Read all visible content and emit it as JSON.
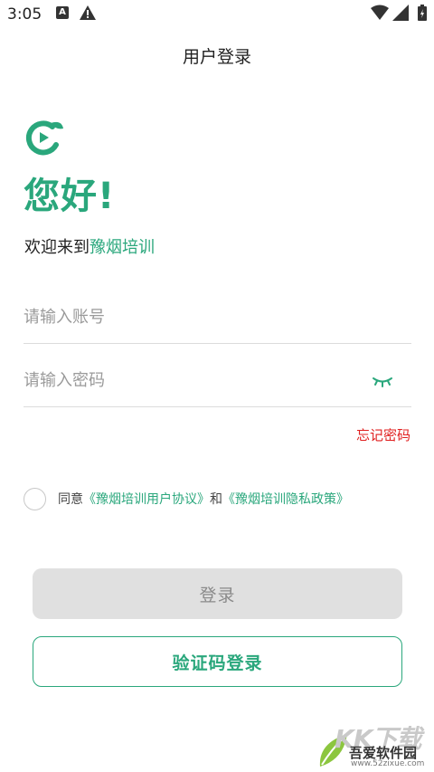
{
  "status_bar": {
    "time": "3:05",
    "a_badge": "A",
    "icons": [
      "a-badge-icon",
      "warning-icon",
      "wifi-icon",
      "cell-signal-icon",
      "battery-icon"
    ]
  },
  "header": {
    "title": "用户登录"
  },
  "hero": {
    "greeting": "您好!",
    "welcome_prefix": "欢迎来到",
    "brand": "豫烟培训"
  },
  "form": {
    "account_placeholder": "请输入账号",
    "password_placeholder": "请输入密码",
    "forgot_label": "忘记密码"
  },
  "agreement": {
    "prefix": "同意",
    "link1": "《豫烟培训用户协议》",
    "and": "和",
    "link2": "《豫烟培训隐私政策》"
  },
  "buttons": {
    "login": "登录",
    "sms_login": "验证码登录"
  },
  "watermark": {
    "mark": "KK下载",
    "name": "吾爱软件园",
    "url": "www.52zixue.com"
  },
  "colors": {
    "accent": "#2aa77c",
    "danger": "#e02020",
    "disabled_bg": "#e0e0e0",
    "divider": "#dcdcdc"
  }
}
